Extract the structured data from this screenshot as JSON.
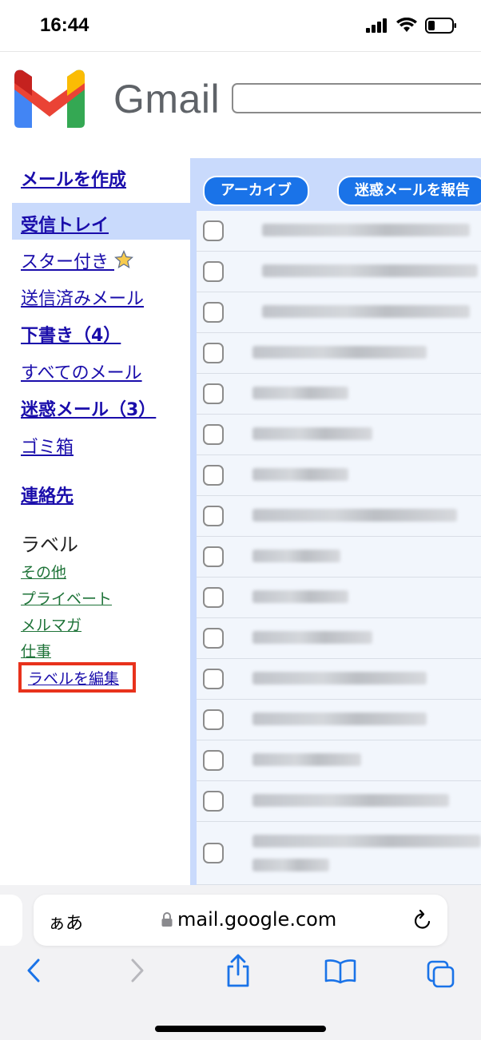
{
  "status": {
    "time": "16:44"
  },
  "header": {
    "brand": "Gmail"
  },
  "sidebar": {
    "compose": "メールを作成",
    "items": [
      {
        "label": "受信トレイ"
      },
      {
        "label": "スター付き"
      },
      {
        "label": "送信済みメール"
      },
      {
        "label": "下書き（4）"
      },
      {
        "label": "すべてのメール"
      },
      {
        "label": "迷惑メール（3）"
      },
      {
        "label": "ゴミ箱"
      }
    ],
    "contacts": "連絡先",
    "labels_heading": "ラベル",
    "labels": [
      "その他",
      "プライベート",
      "メルマガ",
      "仕事"
    ],
    "edit_labels": "ラベルを編集"
  },
  "toolbar": {
    "archive": "アーカイブ",
    "report_spam": "迷惑メールを報告"
  },
  "browser": {
    "text_size": "ぁあ",
    "url": "mail.google.com"
  },
  "colors": {
    "accent": "#1a73e8",
    "selected": "#c9dafc",
    "link": "#1a0dab",
    "label_link": "#1e7338",
    "highlight": "#e8321c"
  }
}
